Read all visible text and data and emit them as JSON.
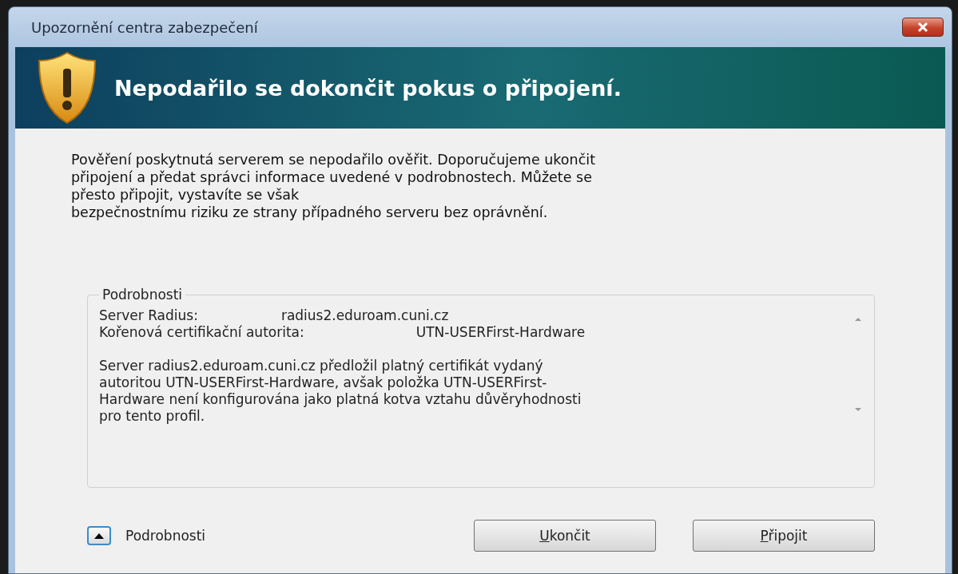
{
  "window": {
    "title": "Upozornění centra zabezpečení"
  },
  "header": {
    "title": "Nepodařilo se dokončit pokus o připojení."
  },
  "message": {
    "lines": [
      "Pověření poskytnutá serverem se nepodařilo ověřit. Doporučujeme ukončit",
      "připojení a předat správci informace uvedené v podrobnostech. Můžete se",
      "přesto připojit, vystavíte se však",
      "bezpečnostnímu riziku ze strany případného serveru bez oprávnění."
    ]
  },
  "details": {
    "legend": "Podrobnosti",
    "fields": [
      {
        "label": "Server Radius:",
        "value": "radius2.eduroam.cuni.cz",
        "kind": "short"
      },
      {
        "label": "Kořenová certifikační autorita:",
        "value": "UTN-USERFirst-Hardware",
        "kind": "long"
      }
    ],
    "text_lines": [
      "Server radius2.eduroam.cuni.cz předložil platný certifikát vydaný",
      "autoritou UTN-USERFirst-Hardware, avšak položka UTN-USERFirst-",
      "Hardware není konfigurována jako platná kotva vztahu důvěryhodnosti",
      "pro tento profil."
    ]
  },
  "toggle": {
    "label": "Podrobnosti",
    "expanded": true
  },
  "buttons": [
    {
      "label": "Ukončit",
      "underline_first": true
    },
    {
      "label": "Připojit",
      "underline_first": true
    }
  ]
}
